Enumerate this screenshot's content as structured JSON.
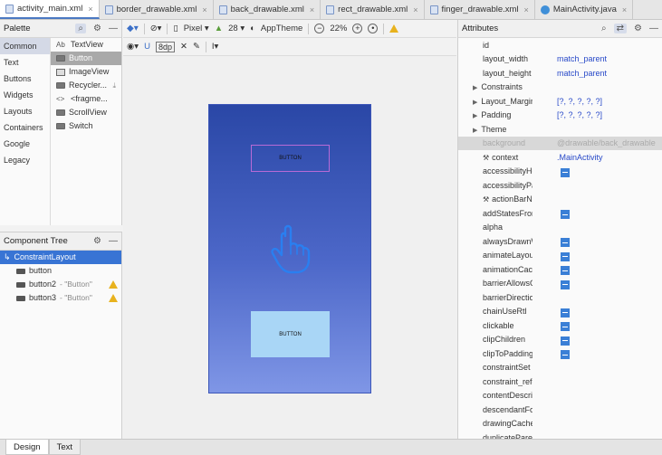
{
  "tabs": [
    {
      "label": "activity_main.xml",
      "kind": "file",
      "active": true
    },
    {
      "label": "border_drawable.xml",
      "kind": "file",
      "active": false
    },
    {
      "label": "back_drawable.xml",
      "kind": "file",
      "active": false
    },
    {
      "label": "rect_drawable.xml",
      "kind": "file",
      "active": false
    },
    {
      "label": "finger_drawable.xml",
      "kind": "file",
      "active": false
    },
    {
      "label": "MainActivity.java",
      "kind": "java",
      "active": false
    }
  ],
  "tab_close": "×",
  "palette": {
    "title": "Palette",
    "categories": [
      "Common",
      "Text",
      "Buttons",
      "Widgets",
      "Layouts",
      "Containers",
      "Google",
      "Legacy"
    ],
    "items": [
      {
        "label": "TextView",
        "prefix": "Ab"
      },
      {
        "label": "Button",
        "prefix": ""
      },
      {
        "label": "ImageView",
        "prefix": ""
      },
      {
        "label": "Recycler...",
        "prefix": ""
      },
      {
        "label": "<fragme...",
        "prefix": "<>"
      },
      {
        "label": "ScrollView",
        "prefix": ""
      },
      {
        "label": "Switch",
        "prefix": ""
      }
    ]
  },
  "tree": {
    "title": "Component Tree",
    "rows": [
      {
        "label": "ConstraintLayout",
        "hint": ""
      },
      {
        "label": "button",
        "hint": ""
      },
      {
        "label": "button2",
        "hint": "- \"Button\""
      },
      {
        "label": "button3",
        "hint": "- \"Button\""
      }
    ]
  },
  "toolbar": {
    "device": "Pixel",
    "api": "28",
    "theme": "AppTheme",
    "zoom": "22%",
    "margin": "8dp"
  },
  "device_preview": {
    "button_top": "BUTTON",
    "button_bottom": "BUTTON"
  },
  "attributes": {
    "title": "Attributes",
    "rows": [
      {
        "name": "id",
        "value": ""
      },
      {
        "name": "layout_width",
        "value": "match_parent"
      },
      {
        "name": "layout_height",
        "value": "match_parent"
      },
      {
        "name": "Constraints",
        "value": "",
        "expandable": true
      },
      {
        "name": "Layout_Margin",
        "value": "[?, ?, ?, ?, ?]",
        "expandable": true
      },
      {
        "name": "Padding",
        "value": "[?, ?, ?, ?, ?]",
        "expandable": true
      },
      {
        "name": "Theme",
        "value": "",
        "expandable": true
      },
      {
        "name": "background",
        "value": "@drawable/back_drawable",
        "dim": true
      },
      {
        "name": "context",
        "value": ".MainActivity",
        "wrench": true
      },
      {
        "name": "accessibilityHeading",
        "value": "",
        "box": true
      },
      {
        "name": "accessibilityPaneTitle",
        "value": ""
      },
      {
        "name": "actionBarNavMode",
        "value": "",
        "wrench": true
      },
      {
        "name": "addStatesFromChildren",
        "value": "",
        "box": true
      },
      {
        "name": "alpha",
        "value": ""
      },
      {
        "name": "alwaysDrawnWithCache",
        "value": "",
        "box": true
      },
      {
        "name": "animateLayoutChanges",
        "value": "",
        "box": true
      },
      {
        "name": "animationCache",
        "value": "",
        "box": true
      },
      {
        "name": "barrierAllowsGoneWidgets",
        "value": "",
        "box": true
      },
      {
        "name": "barrierDirection",
        "value": ""
      },
      {
        "name": "chainUseRtl",
        "value": "",
        "box": true
      },
      {
        "name": "clickable",
        "value": "",
        "box": true
      },
      {
        "name": "clipChildren",
        "value": "",
        "box": true
      },
      {
        "name": "clipToPadding",
        "value": "",
        "box": true
      },
      {
        "name": "constraintSet",
        "value": ""
      },
      {
        "name": "constraint_referenced_ids",
        "value": ""
      },
      {
        "name": "contentDescription",
        "value": ""
      },
      {
        "name": "descendantFocusability",
        "value": ""
      },
      {
        "name": "drawingCacheQuality",
        "value": ""
      },
      {
        "name": "duplicateParentState",
        "value": ""
      }
    ]
  },
  "bottom_tabs": [
    "Design",
    "Text"
  ],
  "colors": {
    "accent": "#3874d4",
    "gradient_top": "#2a47a6",
    "gradient_bottom": "#7f96e6",
    "warning": "#e8b21e"
  }
}
